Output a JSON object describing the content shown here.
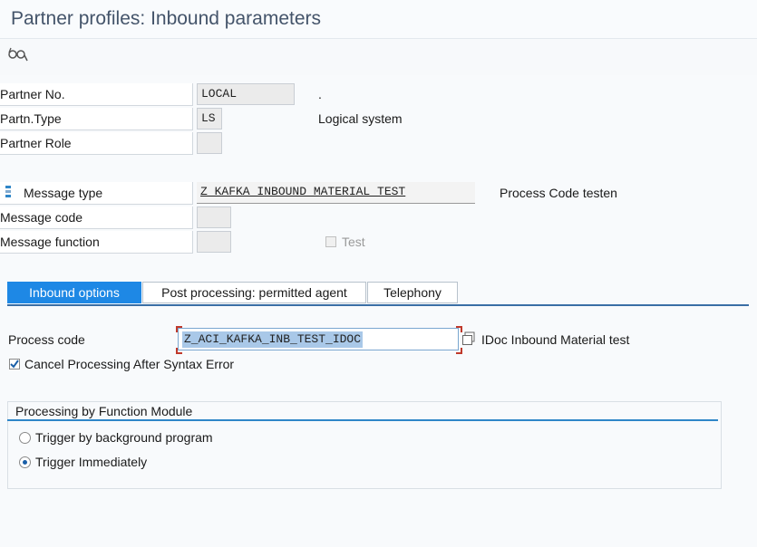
{
  "window": {
    "title": "Partner profiles: Inbound parameters"
  },
  "toolbar": {
    "icon": "glasses-icon"
  },
  "partner": {
    "no_label": "Partner No.",
    "no_value": "LOCAL",
    "no_desc": ".",
    "type_label": "Partn.Type",
    "type_value": "LS",
    "type_desc": "Logical system",
    "role_label": "Partner Role",
    "role_value": ""
  },
  "message": {
    "type_label": "Message type",
    "type_value": "Z_KAFKA_INBOUND_MATERIAL_TEST",
    "type_desc": "Process Code testen",
    "code_label": "Message code",
    "code_value": "",
    "function_label": "Message function",
    "function_value": "",
    "test_label": "Test",
    "test_checked": false
  },
  "tabs": [
    {
      "label": "Inbound options",
      "active": true
    },
    {
      "label": "Post processing: permitted agent",
      "active": false
    },
    {
      "label": "Telephony",
      "active": false
    }
  ],
  "inbound": {
    "process_code_label": "Process code",
    "process_code_value": "Z_ACI_KAFKA_INB_TEST_IDOC",
    "process_code_desc": "IDoc Inbound Material test",
    "cancel_label": "Cancel Processing After Syntax Error",
    "cancel_checked": true
  },
  "processing": {
    "group_title": "Processing by Function Module",
    "options": [
      {
        "label": "Trigger by background program",
        "selected": false
      },
      {
        "label": "Trigger Immediately",
        "selected": true
      }
    ]
  },
  "colors": {
    "accent": "#1e88e5",
    "title": "#44546a"
  }
}
